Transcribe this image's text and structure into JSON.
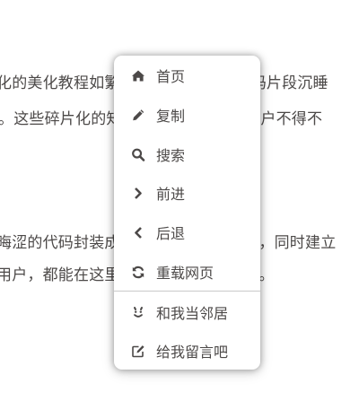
{
  "background_text": {
    "line1": "化的美化教程如繁星般，GitHub的代码片段沉睡",
    "line2": "。这些碎片化的知识让追求个性化的用户不得不",
    "line3": "晦涩的代码封装成即插即用的解决方案，同时建立",
    "line4": "用户，都能在这里找到适合自己的路径。"
  },
  "context_menu": {
    "items": [
      {
        "label": "首页",
        "icon": "home-icon"
      },
      {
        "label": "复制",
        "icon": "pencil-icon"
      },
      {
        "label": "搜索",
        "icon": "search-icon"
      },
      {
        "label": "前进",
        "icon": "chevron-right-icon"
      },
      {
        "label": "后退",
        "icon": "chevron-left-icon"
      },
      {
        "label": "重载网页",
        "icon": "reload-icon"
      }
    ],
    "extra_items": [
      {
        "label": "和我当邻居",
        "icon": "smile-icon"
      },
      {
        "label": "给我留言吧",
        "icon": "edit-note-icon"
      }
    ]
  },
  "colors": {
    "text": "#4c4948",
    "menu_bg": "#ffffff",
    "divider": "#c9c9c9"
  }
}
